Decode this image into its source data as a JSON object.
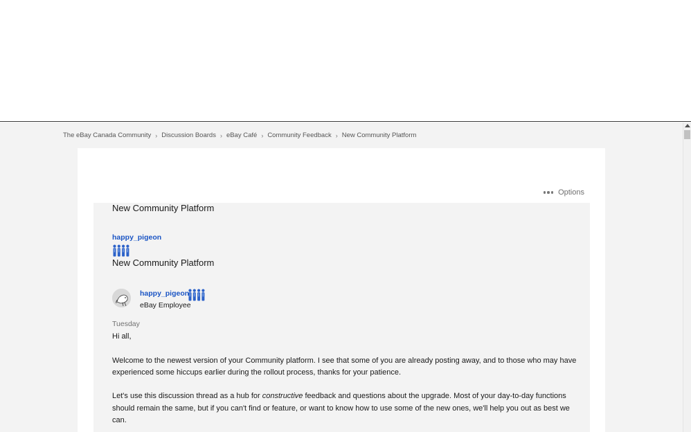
{
  "breadcrumb": [
    {
      "label": "The eBay Canada Community"
    },
    {
      "label": "Discussion Boards"
    },
    {
      "label": "eBay Café"
    },
    {
      "label": "Community Feedback"
    },
    {
      "label": "New Community Platform"
    }
  ],
  "options_label": "Options",
  "post": {
    "title": "New Community Platform",
    "author": "happy_pigeon",
    "role": "eBay Employee",
    "date": "Tuesday",
    "greeting": "Hi all,",
    "para1": "Welcome to the newest version of your Community platform. I see that some of you are already posting away, and to those who may have experienced some hiccups earlier during the rollout process, thanks for your patience.",
    "para2_start": "Let's use this discussion thread as a hub for ",
    "para2_emphasis": "constructive",
    "para2_end": " feedback and questions about the upgrade. Most of your day-to-day functions should remain the same, but if you can't find or feature, or want to know how to use some of the new ones, we'll help you out as best we can."
  },
  "colors": {
    "link": "#1b55c4",
    "rank_icon": "#2c62c9",
    "background": "#f3f3f3"
  },
  "icons": [
    "more-dots-icon",
    "employee-rank-icon",
    "avatar-pigeon-icon",
    "scroll-up-arrow-icon"
  ]
}
